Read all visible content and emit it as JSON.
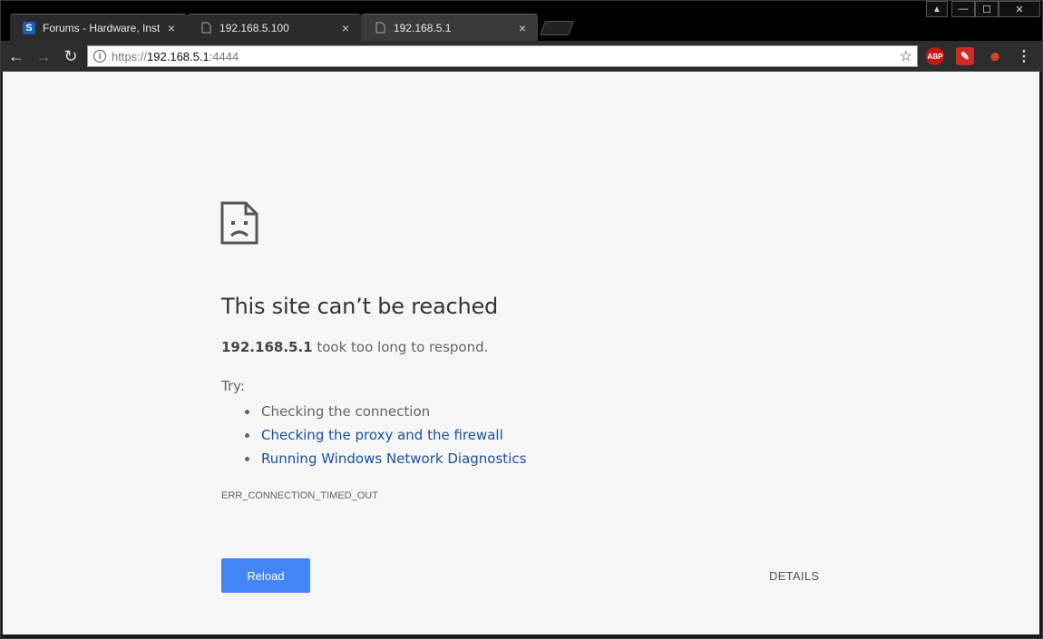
{
  "tabs": [
    {
      "title": "Forums - Hardware, Insta",
      "favicon": "brand-s-icon",
      "favicon_text": "S",
      "close": "×"
    },
    {
      "title": "192.168.5.100",
      "favicon": "page-icon",
      "close": "×"
    },
    {
      "title": "192.168.5.1",
      "favicon": "page-icon",
      "close": "×"
    }
  ],
  "window_controls": {
    "minimize": "—",
    "maximize": "☐",
    "close": "✕",
    "user": "▲"
  },
  "toolbar": {
    "back": "←",
    "forward": "→",
    "reload": "↻"
  },
  "omnibox": {
    "scheme": "https://",
    "host": "192.168.5.1",
    "port": ":4444",
    "info": "i",
    "star": "☆"
  },
  "extensions": {
    "abp": "ABP",
    "e2": "✎",
    "e3": "☻",
    "menu": "⋮"
  },
  "error": {
    "heading": "This site can’t be reached",
    "host": "192.168.5.1",
    "summary_rest": " took too long to respond.",
    "try_label": "Try:",
    "suggestions": [
      {
        "text": "Checking the connection",
        "link": false
      },
      {
        "text": "Checking the proxy and the firewall",
        "link": true
      },
      {
        "text": "Running Windows Network Diagnostics",
        "link": true
      }
    ],
    "code": "ERR_CONNECTION_TIMED_OUT",
    "reload_label": "Reload",
    "details_label": "DETAILS"
  },
  "colors": {
    "accent": "#4285f4",
    "link": "#1a4f9c",
    "chrome_dark": "#2d2d2d"
  }
}
